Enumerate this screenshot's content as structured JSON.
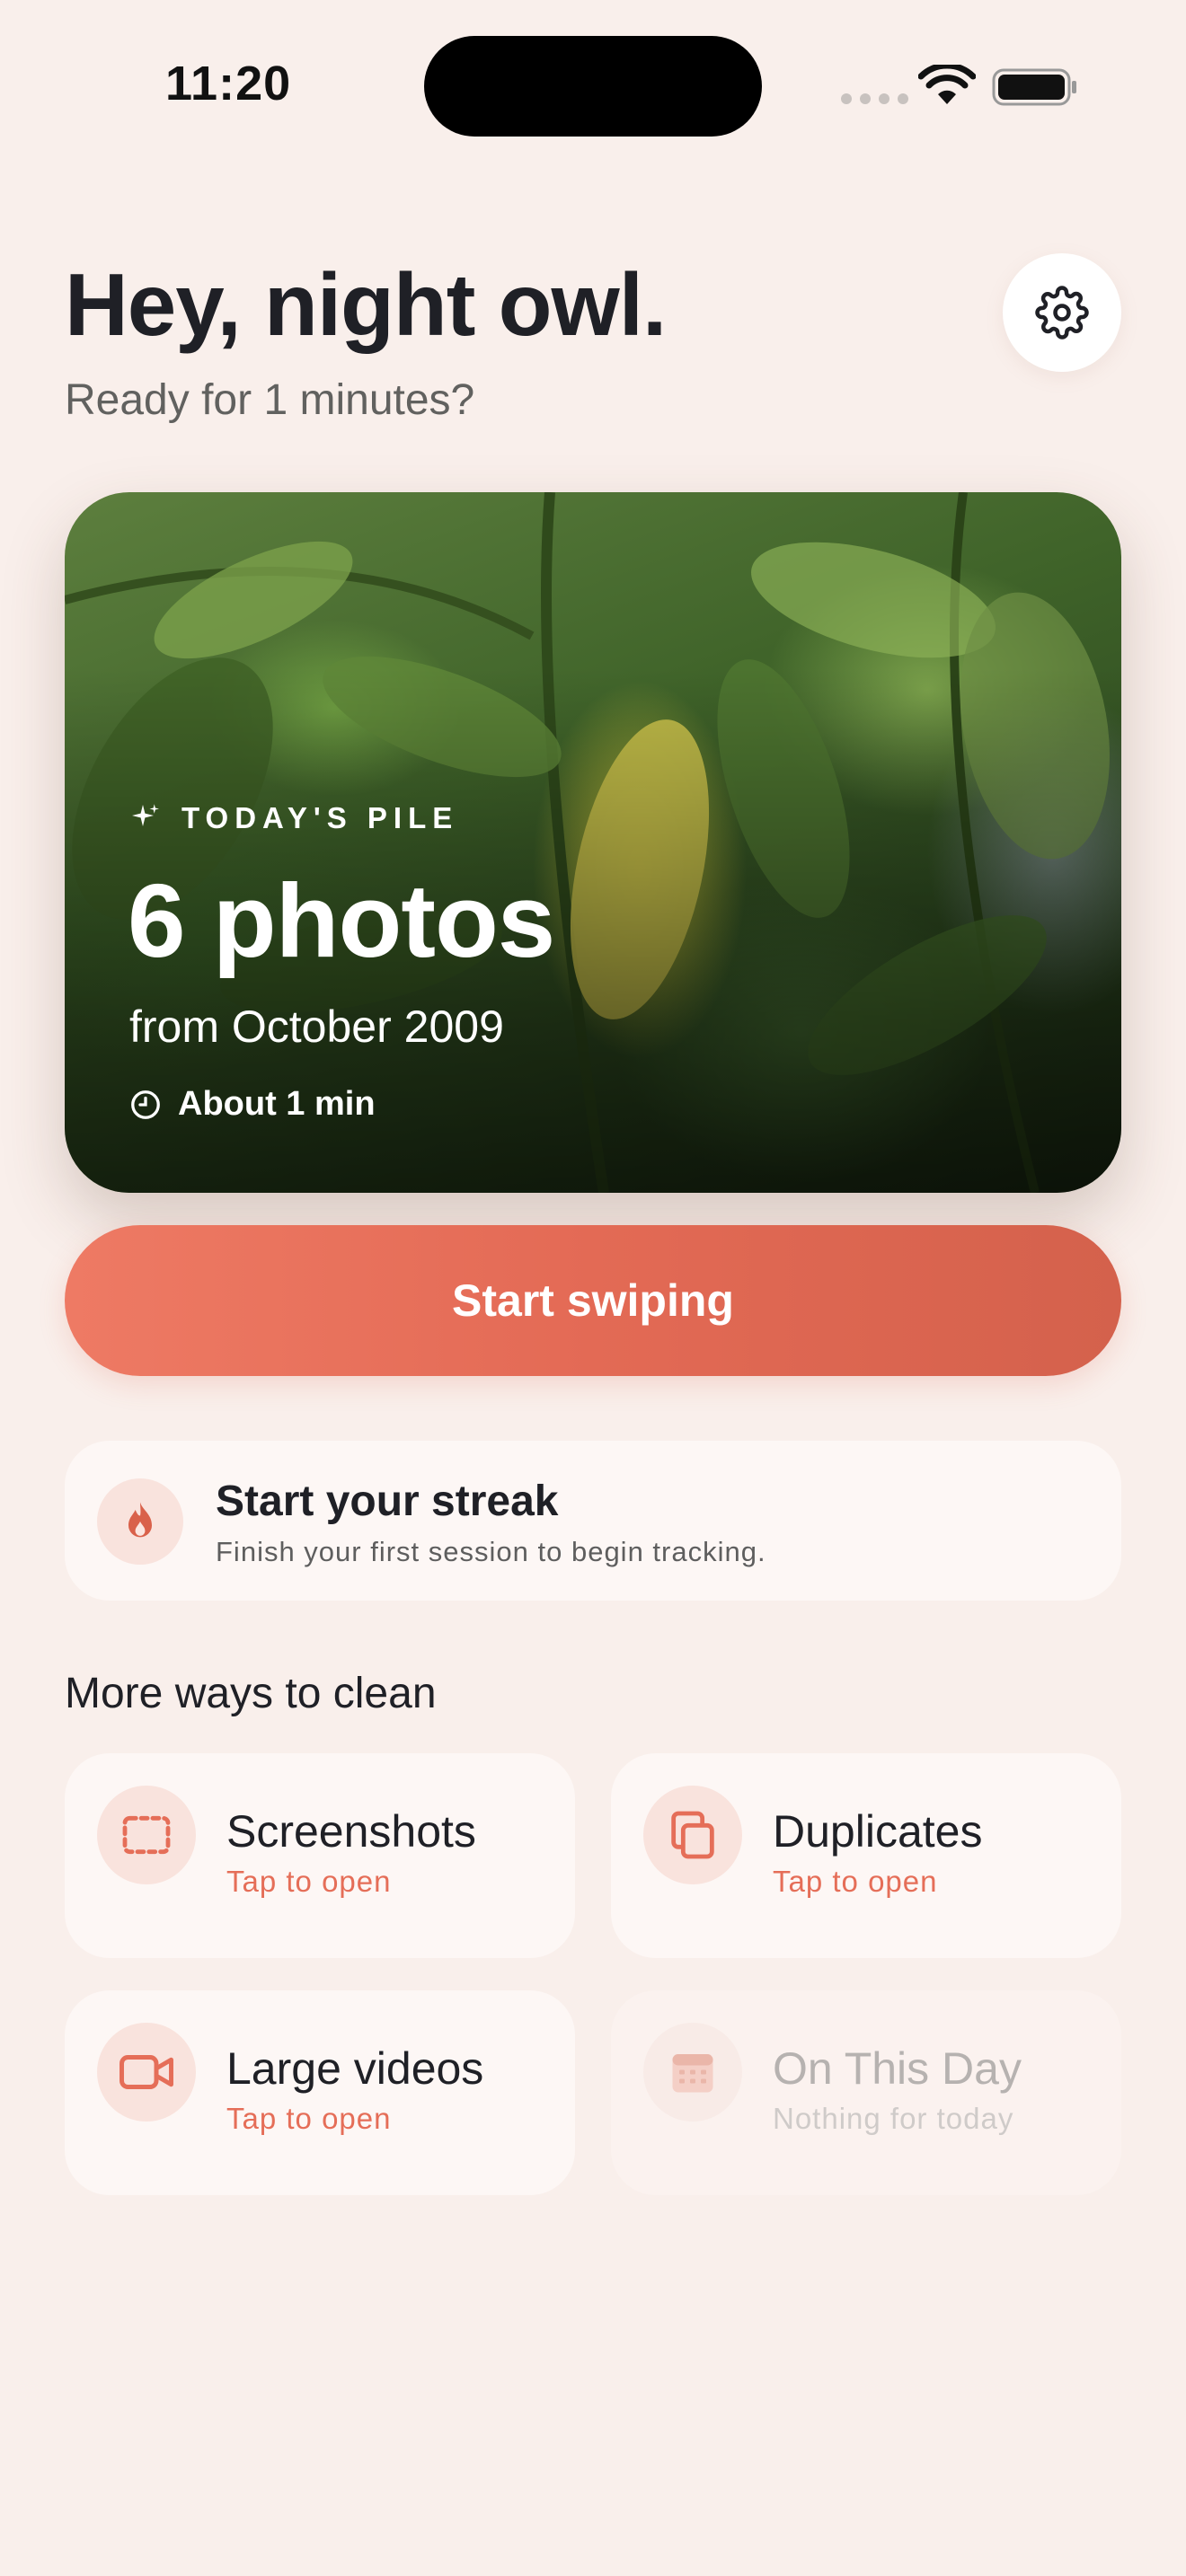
{
  "status_bar": {
    "time": "11:20"
  },
  "header": {
    "greeting": "Hey, night owl.",
    "subtitle": "Ready for 1 minutes?",
    "settings_icon": "gear-icon"
  },
  "hero": {
    "kicker": "TODAY'S PILE",
    "count": "6 photos",
    "from": "from October 2009",
    "duration": "About 1 min"
  },
  "start_button": {
    "label": "Start swiping",
    "color_from": "#ee7a64",
    "color_to": "#d4614c"
  },
  "streak": {
    "title": "Start your streak",
    "subtitle": "Finish your first session to begin tracking.",
    "icon": "flame-icon"
  },
  "more": {
    "title": "More ways to clean",
    "tiles": [
      {
        "title": "Screenshots",
        "subtitle": "Tap to open",
        "icon": "screenshot-icon",
        "enabled": true
      },
      {
        "title": "Duplicates",
        "subtitle": "Tap to open",
        "icon": "duplicate-icon",
        "enabled": true
      },
      {
        "title": "Large videos",
        "subtitle": "Tap to open",
        "icon": "video-camera-icon",
        "enabled": true
      },
      {
        "title": "On This Day",
        "subtitle": "Nothing for today",
        "icon": "calendar-icon",
        "enabled": false
      }
    ]
  },
  "colors": {
    "background": "#f9efeb",
    "accent": "#e56e58",
    "text": "#1f2026"
  }
}
